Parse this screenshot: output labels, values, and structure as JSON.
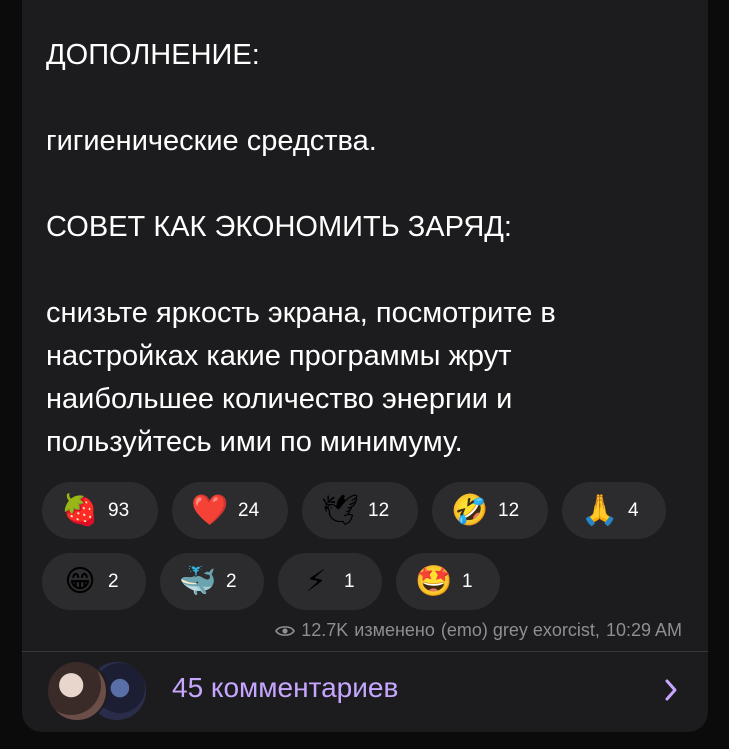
{
  "message": {
    "supplement_heading": "ДОПОЛНЕНИЕ:",
    "hygiene": "гигиенические средства.",
    "advice_heading": "СОВЕТ КАК ЭКОНОМИТЬ ЗАРЯД:",
    "advice_lines": [
      "снизьте яркость экрана, посмотрите в",
      "настройках какие программы жрут",
      "наибольшее количество энергии и",
      "пользуйтесь ими по минимуму."
    ]
  },
  "reactions": [
    {
      "name": "strawberry",
      "emoji": "🍓",
      "count": "93"
    },
    {
      "name": "heart",
      "emoji": "❤️",
      "count": "24"
    },
    {
      "name": "dove",
      "emoji": "🕊",
      "count": "12"
    },
    {
      "name": "rofl",
      "emoji": "🤣",
      "count": "12"
    },
    {
      "name": "pray",
      "emoji": "🙏",
      "count": "4"
    },
    {
      "name": "grin",
      "emoji": "😁",
      "count": "2"
    },
    {
      "name": "whale",
      "emoji": "🐳",
      "count": "2"
    },
    {
      "name": "zap",
      "emoji": "⚡",
      "count": "1"
    },
    {
      "name": "star-struck",
      "emoji": "🤩",
      "count": "1"
    }
  ],
  "meta": {
    "views": "12.7K",
    "edited": "изменено",
    "author": "(emo) grey exorcist,",
    "time": "10:29 AM"
  },
  "comments": {
    "label": "45 комментариев"
  },
  "colors": {
    "bubble": "#1c1c1e",
    "chip": "#2c2c2e",
    "accent": "#c7a6ff",
    "meta": "#8e8e93"
  }
}
